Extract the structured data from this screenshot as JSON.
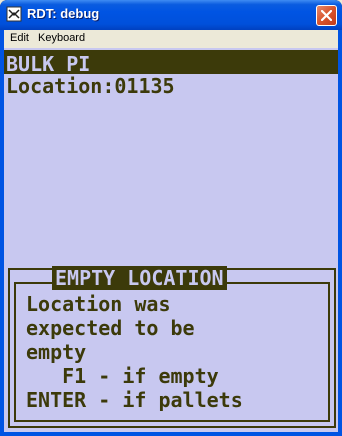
{
  "window": {
    "title": "RDT: debug",
    "close_glyph": "close-icon"
  },
  "menu": {
    "items": [
      "Edit",
      "Keyboard"
    ]
  },
  "terminal": {
    "header": "BULK PI",
    "location_line": "Location:01135",
    "dialog": {
      "title": "EMPTY LOCATION",
      "lines": [
        "Location was",
        "expected to be",
        "empty",
        "   F1 - if empty",
        "ENTER - if pallets"
      ]
    }
  },
  "colors": {
    "screen_bg": "#c8c8f0",
    "text": "#3c3a0a",
    "titlebar": "#0054e3"
  }
}
